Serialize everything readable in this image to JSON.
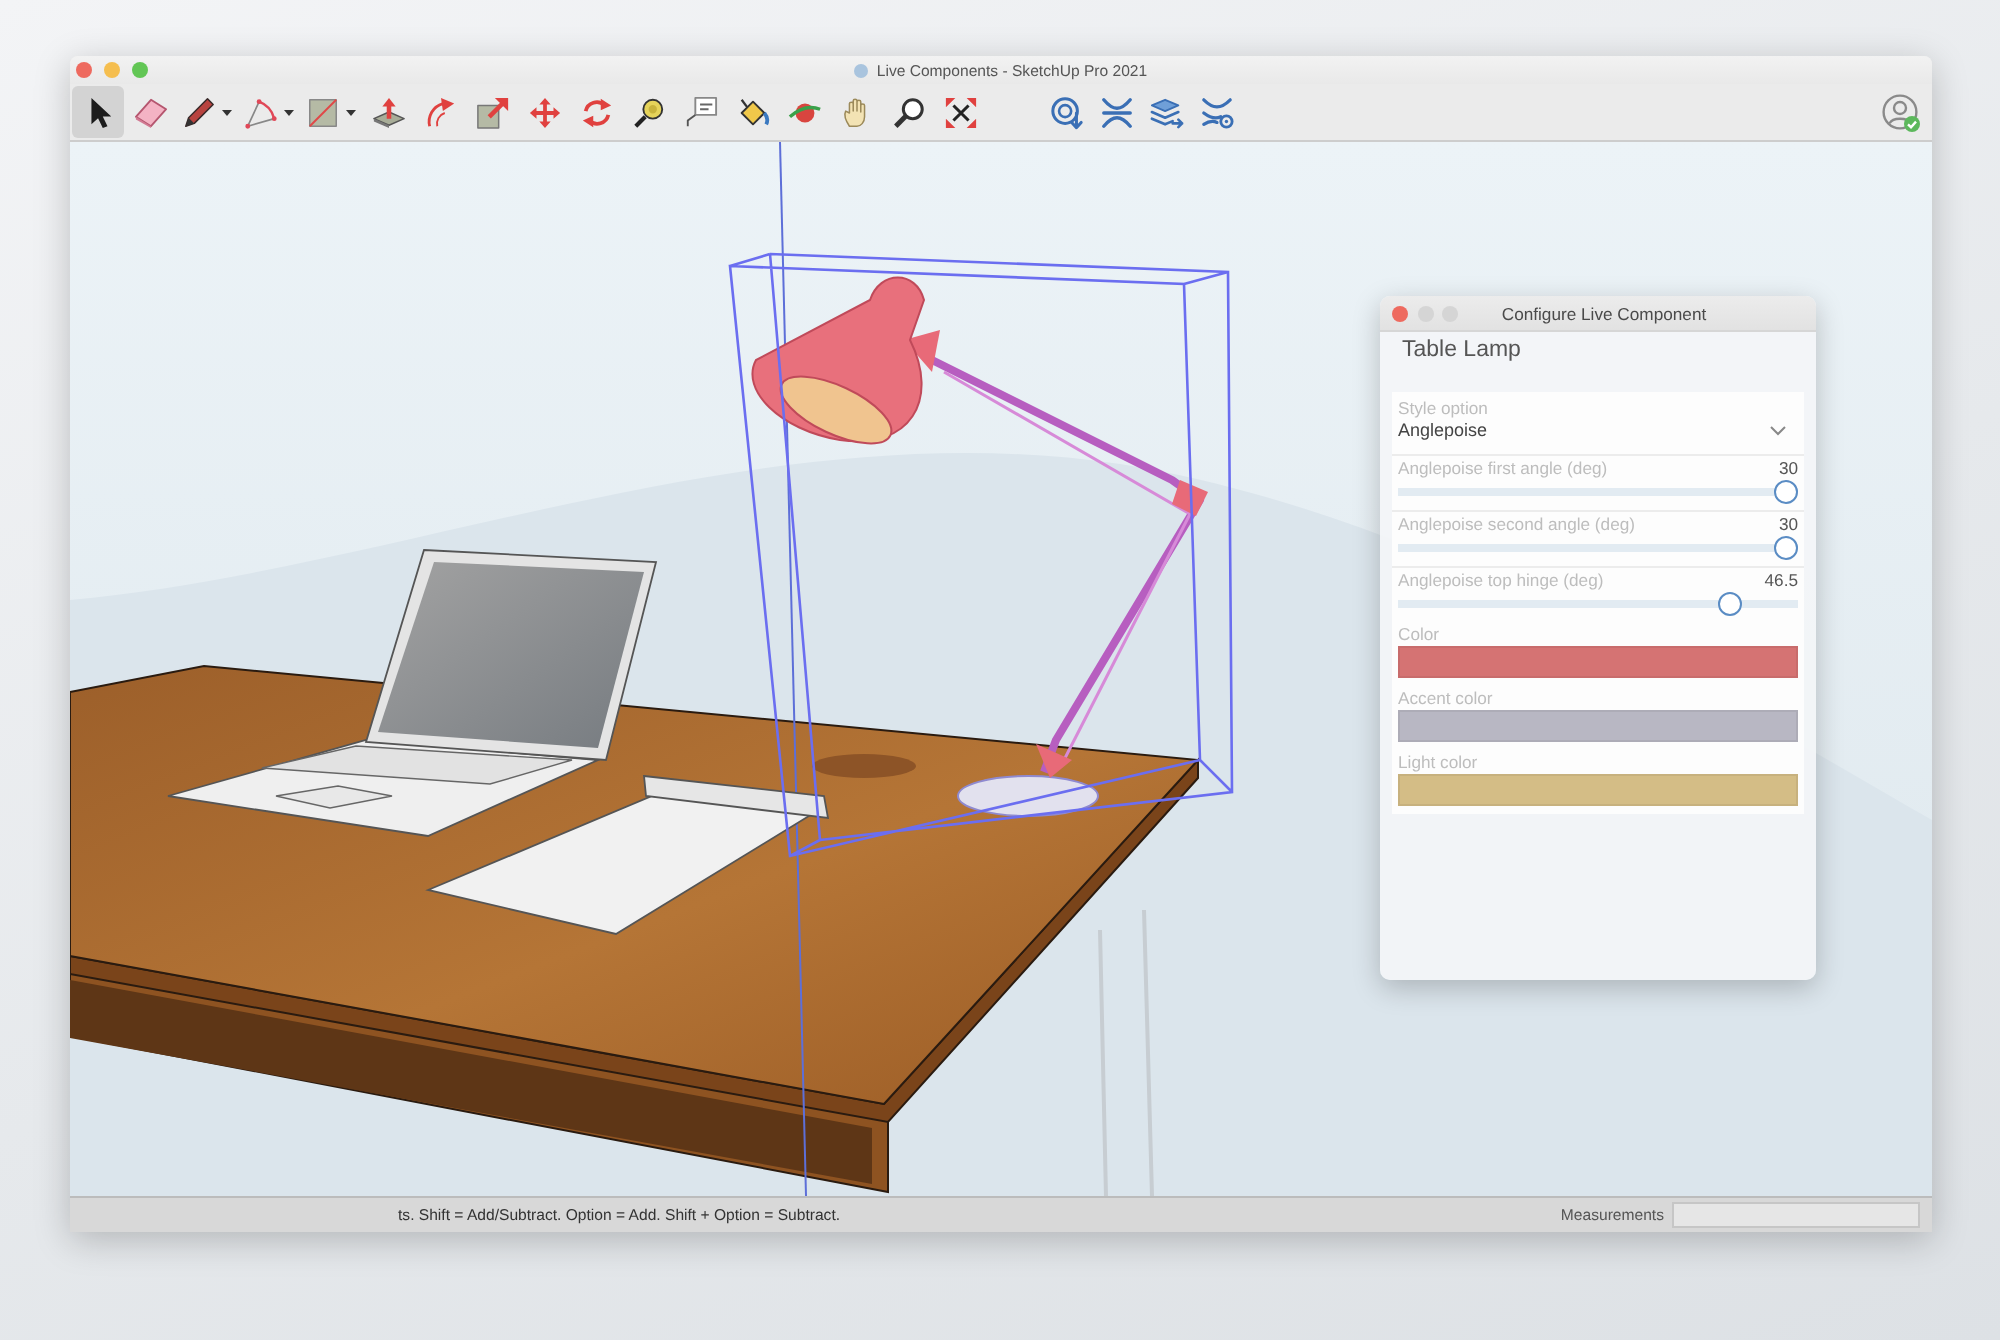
{
  "window": {
    "title": "Live Components - SketchUp Pro 2021"
  },
  "toolbar": {
    "tools": [
      {
        "kind": "select",
        "selected": true,
        "menu": false
      },
      {
        "kind": "eraser",
        "selected": false,
        "menu": false
      },
      {
        "kind": "pencil",
        "selected": false,
        "menu": true
      },
      {
        "kind": "arc",
        "selected": false,
        "menu": true
      },
      {
        "kind": "rectangle",
        "selected": false,
        "menu": true
      },
      {
        "kind": "push_pull",
        "selected": false,
        "menu": false
      },
      {
        "kind": "follow_me",
        "selected": false,
        "menu": false
      },
      {
        "kind": "scale",
        "selected": false,
        "menu": false
      },
      {
        "kind": "move",
        "selected": false,
        "menu": false
      },
      {
        "kind": "rotate",
        "selected": false,
        "menu": false
      },
      {
        "kind": "tape_measure",
        "selected": false,
        "menu": false
      },
      {
        "kind": "text",
        "selected": false,
        "menu": false
      },
      {
        "kind": "paint_bucket",
        "selected": false,
        "menu": false
      },
      {
        "kind": "orbit",
        "selected": false,
        "menu": false
      },
      {
        "kind": "pan",
        "selected": false,
        "menu": false
      },
      {
        "kind": "zoom",
        "selected": false,
        "menu": false
      },
      {
        "kind": "zoom_extents",
        "selected": false,
        "menu": false
      }
    ],
    "extensions": [
      {
        "kind": "download"
      },
      {
        "kind": "weave"
      },
      {
        "kind": "layers_export"
      },
      {
        "kind": "layers_settings"
      }
    ],
    "account": {
      "signed_in": true
    }
  },
  "viewport": {
    "lamp_selected": true
  },
  "dialog": {
    "title": "Configure Live Component",
    "heading": "Table Lamp",
    "fields": [
      {
        "kind": "dropdown",
        "label": "Style option",
        "value": "Anglepoise"
      },
      {
        "kind": "slider",
        "label": "Anglepoise first angle (deg)",
        "reading": "30",
        "level": 1
      },
      {
        "kind": "slider",
        "label": "Anglepoise second angle (deg)",
        "reading": "30",
        "level": 1
      },
      {
        "kind": "slider",
        "label": "Anglepoise top hinge (deg)",
        "reading": "46.5",
        "level": 0.85
      },
      {
        "kind": "color",
        "label": "Color",
        "color": "#d57373"
      },
      {
        "kind": "color",
        "label": "Accent color",
        "color": "#b8b7c3"
      },
      {
        "kind": "color",
        "label": "Light color",
        "color": "#d4bd86"
      }
    ]
  },
  "status_bar": {
    "hint": "ts. Shift = Add/Subtract. Option = Add. Shift + Option = Subtract.",
    "measurements_label": "Measurements"
  }
}
